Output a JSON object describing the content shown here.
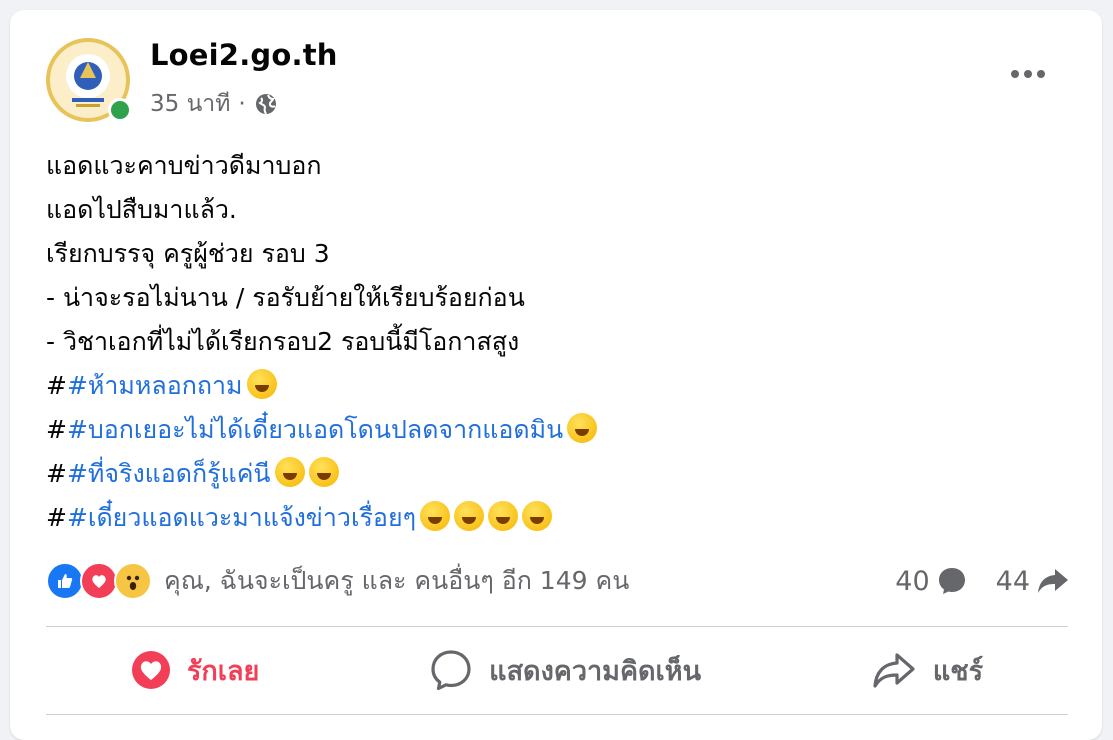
{
  "post": {
    "page_name": "Loei2.go.th",
    "time": "35 นาที",
    "separator": "·",
    "privacy_icon": "globe-icon",
    "more_icon": "more-horizontal-icon",
    "lines": [
      "แอดแวะคาบข่าวดีมาบอก",
      "แอดไปสืบมาแล้ว.",
      "เรียกบรรจุ ครูผู้ช่วย รอบ 3",
      "- น่าจะรอไม่นาน / รอรับย้ายให้เรียบร้อยก่อน",
      "- วิชาเอกที่ไม่ได้เรียกรอบ2  รอบนี้มีโอกาสสูง"
    ],
    "hashtags": [
      {
        "plain": "#",
        "tag": "#ห้ามหลอกถาม"
      },
      {
        "plain": "#",
        "tag": "#บอกเยอะไม่ได้เดี๋ยวแอดโดนปลดจากแอดมิน"
      },
      {
        "plain": "#",
        "tag": "#ที่จริงแอดก็รู้แค่นี"
      },
      {
        "plain": "#",
        "tag": "#เดี๋ยวแอดแวะมาแจ้งข่าวเรื่อยๆ"
      }
    ]
  },
  "reactions": {
    "icons": [
      "like-icon",
      "love-icon",
      "wow-icon"
    ],
    "summary": "คุณ, ฉันจะเป็นครู และ คนอื่นๆ อีก 149 คน",
    "comment_count": "40",
    "share_count": "44"
  },
  "actions": {
    "love_label": "รักเลย",
    "comment_label": "แสดงความคิดเห็น",
    "share_label": "แชร์"
  },
  "colors": {
    "accent_love": "#f33e58",
    "hashtag": "#216fdb",
    "online": "#31a24c"
  }
}
